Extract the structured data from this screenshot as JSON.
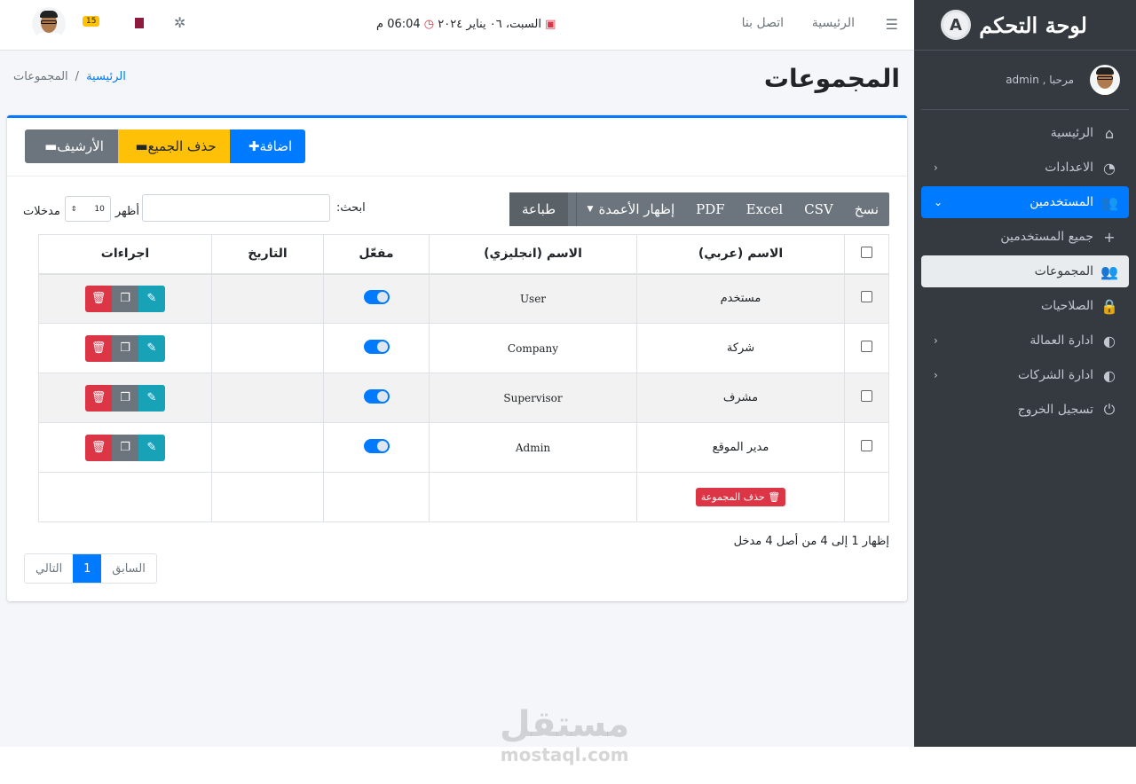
{
  "sidebar": {
    "brand": "لوحة التحكم",
    "brand_logo": "A",
    "greeting": "مرحبا , admin",
    "items": [
      {
        "label": "الرئيسية",
        "icon": "⌂"
      },
      {
        "label": "الاعدادات",
        "icon": "◔",
        "arrow": "‹"
      },
      {
        "label": "المستخدمين",
        "icon": "👥",
        "arrow": "⌄"
      },
      {
        "label": "جميع المستخدمين",
        "icon": "+"
      },
      {
        "label": "المجموعات",
        "icon": "👥"
      },
      {
        "label": "الصلاحيات",
        "icon": "🔒"
      },
      {
        "label": "ادارة العمالة",
        "icon": "◐",
        "arrow": "‹"
      },
      {
        "label": "ادارة الشركات",
        "icon": "◐",
        "arrow": "‹"
      },
      {
        "label": "تسجيل الخروج",
        "icon": "⏻"
      }
    ]
  },
  "topbar": {
    "home": "الرئيسية",
    "contact": "اتصل بنا",
    "date": "السبت، ٠٦ يناير ٢٠٢٤",
    "time": "06:04 م",
    "badge": "15"
  },
  "page": {
    "title": "المجموعات",
    "breadcrumb_home": "الرئيسية",
    "breadcrumb_sep": "/",
    "breadcrumb_current": "المجموعات"
  },
  "buttons": {
    "add": "اضافة",
    "delete_all": "حذف الجميع",
    "archive": "الأرشيف"
  },
  "datatable": {
    "copy": "نسخ",
    "csv": "CSV",
    "excel": "Excel",
    "pdf": "PDF",
    "columns": "إظهار الأعمدة",
    "print": "طباعة",
    "search_label": "ابحث:",
    "show": "أظهر",
    "entries": "مدخلات",
    "page_size": "10",
    "headers": [
      "الاسم (عربي)",
      "الاسم (انجليزي)",
      "مفعّل",
      "التاريخ",
      "اجراءات"
    ],
    "rows": [
      {
        "ar": "مستخدم",
        "en": "User"
      },
      {
        "ar": "شركة",
        "en": "Company"
      },
      {
        "ar": "مشرف",
        "en": "Supervisor"
      },
      {
        "ar": "مدير الموقع",
        "en": "Admin"
      }
    ],
    "delete_group": "حذف المجموعة",
    "info": "إظهار 1 إلى 4 من أصل 4 مدخل",
    "prev": "السابق",
    "page": "1",
    "next": "التالي"
  },
  "watermark": {
    "ar": "مستقل",
    "en": "mostaql.com"
  }
}
